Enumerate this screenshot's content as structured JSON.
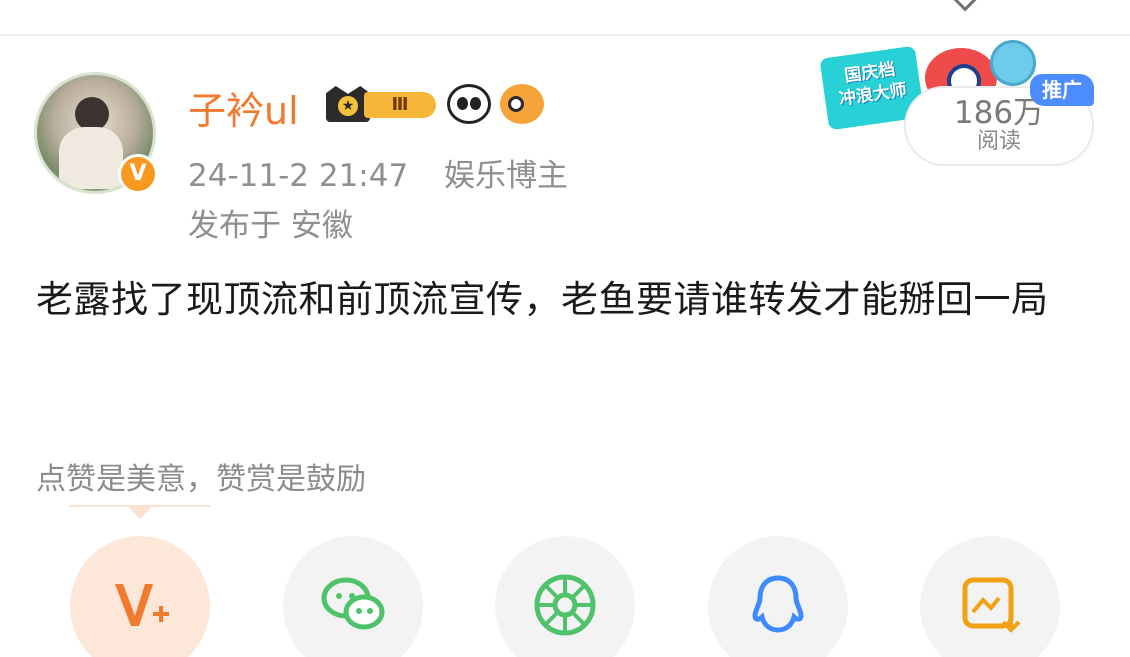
{
  "post": {
    "author": {
      "name": "子衿ul",
      "level": "Ⅲ",
      "verified_mark": "V"
    },
    "timestamp": "24-11-2 21:47",
    "category": "娱乐博主",
    "location": "发布于 安徽",
    "content": "老露找了现顶流和前顶流宣传，老鱼要请谁转发才能掰回一局",
    "reads": {
      "count": "186万",
      "label": "阅读"
    },
    "promo": {
      "line1": "国庆档",
      "line2": "冲浪大师",
      "tag": "推广"
    }
  },
  "reward_hint": "点赞是美意，赞赏是鼓励",
  "share_actions": [
    {
      "name": "reward",
      "icon": "vplus-icon"
    },
    {
      "name": "wechat",
      "icon": "wechat-icon"
    },
    {
      "name": "moments",
      "icon": "moments-icon"
    },
    {
      "name": "qq",
      "icon": "qq-icon"
    },
    {
      "name": "save-image",
      "icon": "save-image-icon"
    }
  ],
  "colors": {
    "accent": "#f27a2e",
    "wechat": "#4fc26b",
    "qq": "#3d8bff",
    "save": "#f2a116"
  }
}
